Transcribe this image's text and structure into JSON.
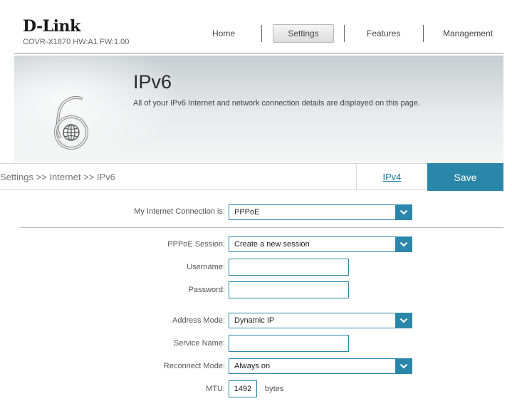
{
  "header": {
    "logo": "D-Link",
    "model_info": "COVR-X1870 HW:A1 FW:1.00",
    "nav": [
      {
        "label": "Home"
      },
      {
        "label": "Settings"
      },
      {
        "label": "Features"
      },
      {
        "label": "Management"
      }
    ],
    "active_nav": "Settings"
  },
  "banner": {
    "title": "IPv6",
    "description": "All of your IPv6 Internet and network connection details are displayed on this page.",
    "icon": "ipv6-globe-icon"
  },
  "crumbbar": {
    "breadcrumb": "Settings >> Internet >> IPv6",
    "ipv4_link": "IPv4",
    "save_label": "Save"
  },
  "form": {
    "connection": {
      "label": "My Internet Connection is:",
      "value": "PPPoE"
    },
    "pppoe_session": {
      "label": "PPPoE Session:",
      "value": "Create a new session"
    },
    "username": {
      "label": "Username:",
      "value": ""
    },
    "password": {
      "label": "Password:",
      "value": ""
    },
    "address_mode": {
      "label": "Address Mode:",
      "value": "Dynamic IP"
    },
    "service_name": {
      "label": "Service Name:",
      "value": ""
    },
    "reconnect_mode": {
      "label": "Reconnect Mode:",
      "value": "Always on"
    },
    "mtu": {
      "label": "MTU:",
      "value": "1492",
      "units": "bytes"
    }
  },
  "colors": {
    "accent": "#2b87a9",
    "link": "#1c7aa3"
  }
}
